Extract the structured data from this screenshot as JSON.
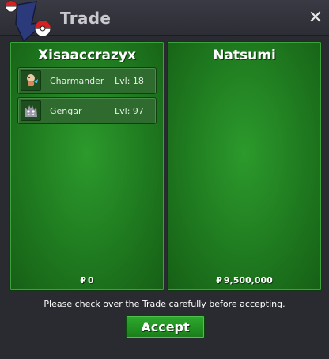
{
  "window": {
    "title": "Trade",
    "close_symbol": "✕"
  },
  "left_panel": {
    "player_name": "Xisaaccrazyx",
    "pokemon": [
      {
        "name": "Charmander",
        "level": "Lvl: 18",
        "icon": "charmander-icon"
      },
      {
        "name": "Gengar",
        "level": "Lvl: 97",
        "icon": "gengar-icon"
      }
    ],
    "currency_symbol": "₽",
    "money": "0"
  },
  "right_panel": {
    "player_name": "Natsumi",
    "currency_symbol": "₽",
    "money": "9,500,000"
  },
  "footer": {
    "notice": "Please check over the Trade carefully before accepting.",
    "accept_label": "Accept"
  },
  "colors": {
    "panel_green": "#1f7a1f",
    "accept_green": "#2eaa2e",
    "window_bg": "#2a2a31"
  }
}
